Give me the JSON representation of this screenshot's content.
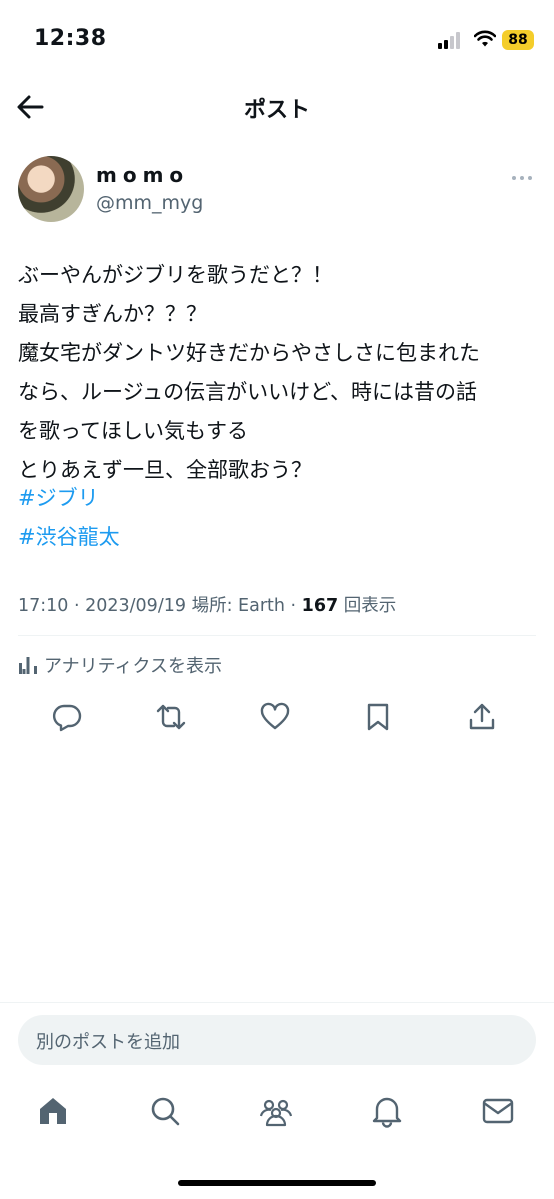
{
  "status_bar": {
    "time": "12:38",
    "battery": "88"
  },
  "header": {
    "title": "ポスト"
  },
  "author": {
    "name": "momo",
    "handle": "@mm_myg"
  },
  "post": {
    "text": "ぶーやんがジブリを歌うだと？！\n最高すぎんか？？？\n魔女宅がダントツ好きだからやさしさに包まれた\nなら、ルージュの伝言がいいけど、時には昔の話\nを歌ってほしい気もする\nとりあえず一旦、全部歌おう？",
    "hashtags": [
      "#ジブリ",
      "#渋谷龍太"
    ],
    "meta": {
      "time_date": "17:10 · 2023/09/19",
      "location": "場所: Earth · ",
      "views": "167",
      "views_label": "回表示"
    }
  },
  "analytics_label": "アナリティクスを表示",
  "reply": {
    "placeholder": "別のポストを追加"
  },
  "colors": {
    "accent": "#1d9bf0",
    "secondary_text": "#536471",
    "divider": "#eff3f4",
    "battery": "#f4cd2a"
  },
  "actions": [
    "reply-icon",
    "repost-icon",
    "like-icon",
    "bookmark-icon",
    "share-icon"
  ],
  "tabs": [
    "home-icon",
    "search-icon",
    "communities-icon",
    "notifications-icon",
    "messages-icon"
  ]
}
